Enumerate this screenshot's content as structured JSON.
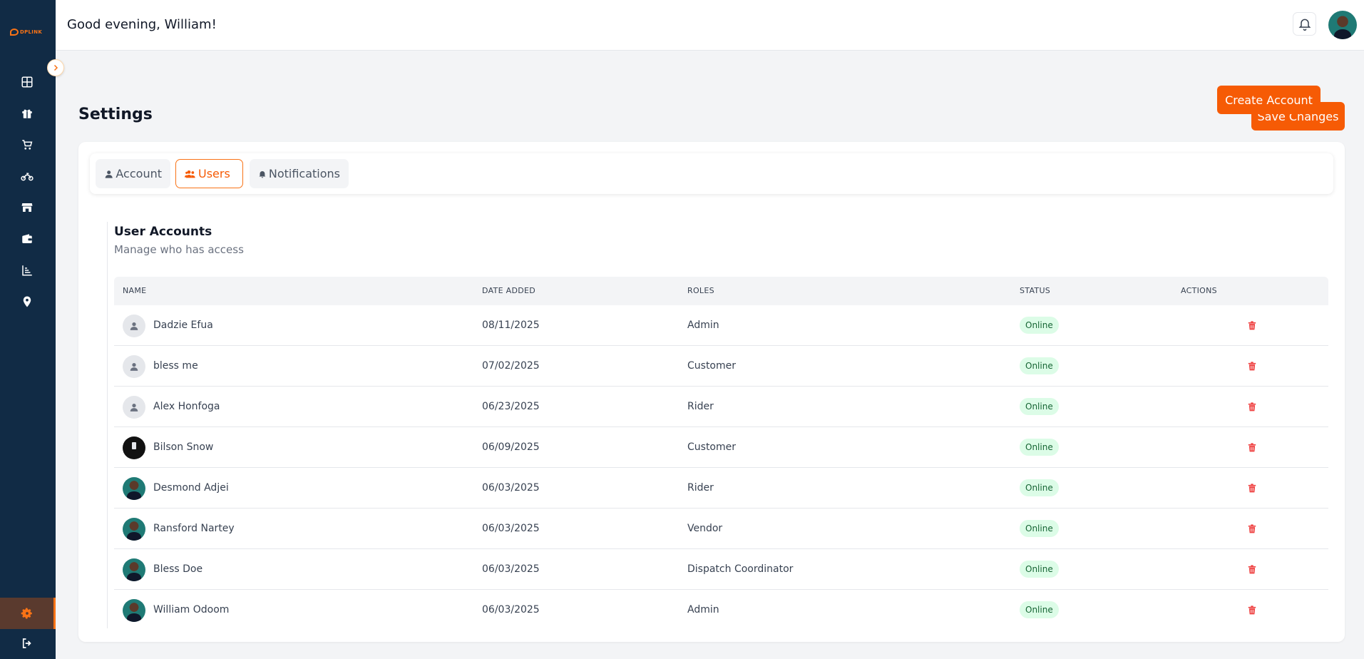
{
  "app": {
    "logo_text": "DPLINK"
  },
  "header": {
    "greeting": "Good evening, William!"
  },
  "page": {
    "title": "Settings",
    "save_label": "Save Changes"
  },
  "tabs": [
    {
      "label": "Account",
      "icon": "user-icon"
    },
    {
      "label": "Users",
      "icon": "users-icon",
      "active": true
    },
    {
      "label": "Notifications",
      "icon": "bell-icon"
    }
  ],
  "section": {
    "title": "User Accounts",
    "subtitle": "Manage who has access",
    "create_label": "Create Account"
  },
  "table": {
    "columns": [
      "NAME",
      "DATE ADDED",
      "ROLES",
      "STATUS",
      "ACTIONS"
    ],
    "rows": [
      {
        "name": "Dadzie Efua",
        "date": "08/11/2025",
        "role": "Admin",
        "status": "Online",
        "avatar": "default"
      },
      {
        "name": "bless me",
        "date": "07/02/2025",
        "role": "Customer",
        "status": "Online",
        "avatar": "default"
      },
      {
        "name": "Alex Honfoga",
        "date": "06/23/2025",
        "role": "Rider",
        "status": "Online",
        "avatar": "default"
      },
      {
        "name": "Bilson Snow",
        "date": "06/09/2025",
        "role": "Customer",
        "status": "Online",
        "avatar": "dark"
      },
      {
        "name": "Desmond Adjei",
        "date": "06/03/2025",
        "role": "Rider",
        "status": "Online",
        "avatar": "photo"
      },
      {
        "name": "Ransford Nartey",
        "date": "06/03/2025",
        "role": "Vendor",
        "status": "Online",
        "avatar": "photo"
      },
      {
        "name": "Bless Doe",
        "date": "06/03/2025",
        "role": "Dispatch Coordinator",
        "status": "Online",
        "avatar": "photo"
      },
      {
        "name": "William Odoom",
        "date": "06/03/2025",
        "role": "Admin",
        "status": "Online",
        "avatar": "photo"
      }
    ]
  },
  "colors": {
    "accent": "#f65b05",
    "sidebar": "#112b45",
    "online_bg": "#dcfce7",
    "online_text": "#166534",
    "danger": "#ef4444"
  }
}
